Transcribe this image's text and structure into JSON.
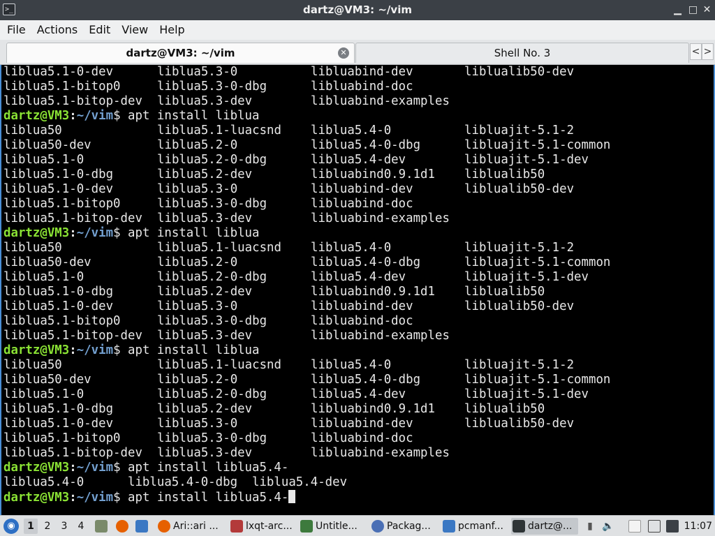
{
  "window": {
    "title": "dartz@VM3: ~/vim",
    "minimize_glyph": "▁",
    "maximize_glyph": "□",
    "close_glyph": "✕"
  },
  "menu": [
    "File",
    "Actions",
    "Edit",
    "View",
    "Help"
  ],
  "tabs": [
    {
      "label": "dartz@VM3: ~/vim",
      "active": true
    },
    {
      "label": "Shell No. 3",
      "active": false
    }
  ],
  "tab_scroll": {
    "left": "<",
    "right": ">"
  },
  "prompt": {
    "user_host": "dartz@VM3",
    "sep": ":",
    "path": "~/vim",
    "symbol": "$"
  },
  "terminal_lines": [
    {
      "type": "cols",
      "cells": [
        "liblua5.1-0-dev",
        "liblua5.3-0",
        "libluabind-dev",
        "liblualib50-dev"
      ]
    },
    {
      "type": "cols",
      "cells": [
        "liblua5.1-bitop0",
        "liblua5.3-0-dbg",
        "libluabind-doc",
        ""
      ]
    },
    {
      "type": "cols",
      "cells": [
        "liblua5.1-bitop-dev",
        "liblua5.3-dev",
        "libluabind-examples",
        ""
      ]
    },
    {
      "type": "prompt",
      "command": " apt install liblua"
    },
    {
      "type": "cols",
      "cells": [
        "liblua50",
        "liblua5.1-luacsnd",
        "liblua5.4-0",
        "libluajit-5.1-2"
      ]
    },
    {
      "type": "cols",
      "cells": [
        "liblua50-dev",
        "liblua5.2-0",
        "liblua5.4-0-dbg",
        "libluajit-5.1-common"
      ]
    },
    {
      "type": "cols",
      "cells": [
        "liblua5.1-0",
        "liblua5.2-0-dbg",
        "liblua5.4-dev",
        "libluajit-5.1-dev"
      ]
    },
    {
      "type": "cols",
      "cells": [
        "liblua5.1-0-dbg",
        "liblua5.2-dev",
        "libluabind0.9.1d1",
        "liblualib50"
      ]
    },
    {
      "type": "cols",
      "cells": [
        "liblua5.1-0-dev",
        "liblua5.3-0",
        "libluabind-dev",
        "liblualib50-dev"
      ]
    },
    {
      "type": "cols",
      "cells": [
        "liblua5.1-bitop0",
        "liblua5.3-0-dbg",
        "libluabind-doc",
        ""
      ]
    },
    {
      "type": "cols",
      "cells": [
        "liblua5.1-bitop-dev",
        "liblua5.3-dev",
        "libluabind-examples",
        ""
      ]
    },
    {
      "type": "prompt",
      "command": " apt install liblua"
    },
    {
      "type": "cols",
      "cells": [
        "liblua50",
        "liblua5.1-luacsnd",
        "liblua5.4-0",
        "libluajit-5.1-2"
      ]
    },
    {
      "type": "cols",
      "cells": [
        "liblua50-dev",
        "liblua5.2-0",
        "liblua5.4-0-dbg",
        "libluajit-5.1-common"
      ]
    },
    {
      "type": "cols",
      "cells": [
        "liblua5.1-0",
        "liblua5.2-0-dbg",
        "liblua5.4-dev",
        "libluajit-5.1-dev"
      ]
    },
    {
      "type": "cols",
      "cells": [
        "liblua5.1-0-dbg",
        "liblua5.2-dev",
        "libluabind0.9.1d1",
        "liblualib50"
      ]
    },
    {
      "type": "cols",
      "cells": [
        "liblua5.1-0-dev",
        "liblua5.3-0",
        "libluabind-dev",
        "liblualib50-dev"
      ]
    },
    {
      "type": "cols",
      "cells": [
        "liblua5.1-bitop0",
        "liblua5.3-0-dbg",
        "libluabind-doc",
        ""
      ]
    },
    {
      "type": "cols",
      "cells": [
        "liblua5.1-bitop-dev",
        "liblua5.3-dev",
        "libluabind-examples",
        ""
      ]
    },
    {
      "type": "prompt",
      "command": " apt install liblua"
    },
    {
      "type": "cols",
      "cells": [
        "liblua50",
        "liblua5.1-luacsnd",
        "liblua5.4-0",
        "libluajit-5.1-2"
      ]
    },
    {
      "type": "cols",
      "cells": [
        "liblua50-dev",
        "liblua5.2-0",
        "liblua5.4-0-dbg",
        "libluajit-5.1-common"
      ]
    },
    {
      "type": "cols",
      "cells": [
        "liblua5.1-0",
        "liblua5.2-0-dbg",
        "liblua5.4-dev",
        "libluajit-5.1-dev"
      ]
    },
    {
      "type": "cols",
      "cells": [
        "liblua5.1-0-dbg",
        "liblua5.2-dev",
        "libluabind0.9.1d1",
        "liblualib50"
      ]
    },
    {
      "type": "cols",
      "cells": [
        "liblua5.1-0-dev",
        "liblua5.3-0",
        "libluabind-dev",
        "liblualib50-dev"
      ]
    },
    {
      "type": "cols",
      "cells": [
        "liblua5.1-bitop0",
        "liblua5.3-0-dbg",
        "libluabind-doc",
        ""
      ]
    },
    {
      "type": "cols",
      "cells": [
        "liblua5.1-bitop-dev",
        "liblua5.3-dev",
        "libluabind-examples",
        ""
      ]
    },
    {
      "type": "prompt",
      "command": " apt install liblua5.4-"
    },
    {
      "type": "text",
      "text": "liblua5.4-0      liblua5.4-0-dbg  liblua5.4-dev"
    },
    {
      "type": "prompt",
      "command": " apt install liblua5.4-",
      "cursor": true
    }
  ],
  "taskbar": {
    "desktops": [
      "1",
      "2",
      "3",
      "4"
    ],
    "active_desktop": "1",
    "tasks": [
      {
        "label": "Ari::ari ...",
        "icon": "firefox-icon",
        "color": "#e66000"
      },
      {
        "label": "lxqt-arc...",
        "icon": "archive-icon",
        "color": "#b33a3a"
      },
      {
        "label": "Untitle...",
        "icon": "document-icon",
        "color": "#3d7a3d"
      },
      {
        "label": "Packag...",
        "icon": "package-icon",
        "color": "#4a6fb5"
      },
      {
        "label": "pcmanf...",
        "icon": "folder-icon",
        "color": "#3b78c3"
      },
      {
        "label": "dartz@...",
        "icon": "terminal-icon",
        "color": "#2e3436",
        "active": true
      }
    ],
    "clock": "11:07"
  }
}
